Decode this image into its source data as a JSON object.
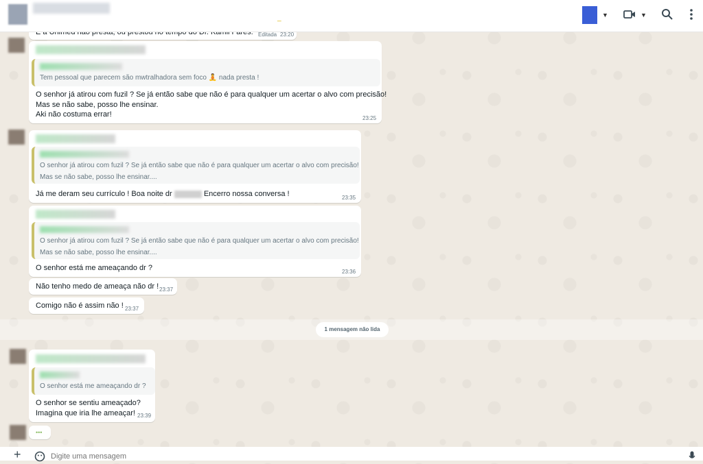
{
  "header": {
    "contact_dot": "_",
    "video_icon": "video-camera-icon",
    "search_icon": "search-icon",
    "menu_icon": "more-vertical-icon"
  },
  "messages": {
    "m0": {
      "text": "E a Unimed não presta, ou prestou no tempo do Dr. Kamil Fares.",
      "edited": "Editada",
      "time": "23:20"
    },
    "m1": {
      "quote": "Tem pessoal que parecem são mwtralhadora sem foco",
      "quote_tail": "nada presta !",
      "lines": [
        "O senhor já atirou com fuzil ? Se já então sabe que não é para qualquer um acertar o alvo com precisão!",
        "Mas se não sabe, posso lhe ensinar.",
        "Aki não costuma errar!"
      ],
      "time": "23:25"
    },
    "m2": {
      "quote_lines": [
        "O senhor já atirou com fuzil ? Se já então sabe que não é para qualquer um acertar o alvo com precisão!",
        "Mas se não sabe, posso lhe ensinar...."
      ],
      "text_a": "Já me deram seu currículo ! Boa noite dr",
      "text_b": "Encerro nossa conversa !",
      "time": "23:35"
    },
    "m3": {
      "quote_lines": [
        "O senhor já atirou com fuzil ? Se já então sabe que não é para qualquer um acertar o alvo com precisão!",
        "Mas se não sabe, posso lhe ensinar...."
      ],
      "text": "O senhor está me ameaçando dr ?",
      "time": "23:36"
    },
    "m4": {
      "text": "Não tenho medo de ameaça não dr !",
      "time": "23:37"
    },
    "m5": {
      "text": "Comigo não é assim não !",
      "time": "23:37"
    },
    "m6": {
      "quote": "O senhor está me ameaçando dr ?",
      "lines": [
        "O senhor se sentiu ameaçado?",
        "Imagina que iria lhe ameaçar!"
      ],
      "time": "23:39"
    },
    "m7": {
      "text": "•••"
    }
  },
  "unread_label": "1 mensagem não lida",
  "composer": {
    "placeholder": "Digite uma mensagem",
    "plus": "+",
    "emoji_icon": "emoji-icon",
    "mic_icon": "mic-icon"
  }
}
